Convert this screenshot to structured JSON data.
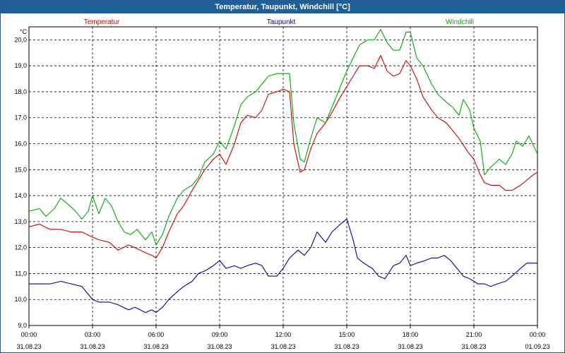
{
  "window": {
    "title": "Temperatur, Taupunkt, Windchill [°C]"
  },
  "chart_data": {
    "type": "line",
    "title": "Temperatur, Taupunkt, Windchill [°C]",
    "ylabel": "°C",
    "ylim": [
      9.0,
      20.5
    ],
    "yticks": [
      "9,0",
      "10,0",
      "11,0",
      "12,0",
      "13,0",
      "14,0",
      "15,0",
      "16,0",
      "17,0",
      "18,0",
      "19,0",
      "20,0"
    ],
    "xlim": [
      0,
      24
    ],
    "xticks": [
      {
        "time": "00:00",
        "date": "31.08.23"
      },
      {
        "time": "03:00",
        "date": "31.08.23"
      },
      {
        "time": "06:00",
        "date": "31.08.23"
      },
      {
        "time": "09:00",
        "date": "31.08.23"
      },
      {
        "time": "12:00",
        "date": "31.08.23"
      },
      {
        "time": "15:00",
        "date": "31.08.23"
      },
      {
        "time": "18:00",
        "date": "31.08.23"
      },
      {
        "time": "21:00",
        "date": "31.08.23"
      },
      {
        "time": "00:00",
        "date": "01.09.23"
      }
    ],
    "grid": true,
    "legend_position": "top",
    "series": [
      {
        "name": "Temperatur",
        "color": "#cc0000",
        "points": [
          [
            0,
            12.8
          ],
          [
            0.5,
            12.9
          ],
          [
            1,
            12.7
          ],
          [
            1.5,
            12.7
          ],
          [
            2,
            12.6
          ],
          [
            2.5,
            12.6
          ],
          [
            3,
            12.4
          ],
          [
            3.3,
            12.3
          ],
          [
            3.8,
            12.2
          ],
          [
            4.2,
            11.9
          ],
          [
            4.7,
            12.1
          ],
          [
            5,
            12.0
          ],
          [
            5.5,
            11.8
          ],
          [
            5.8,
            11.7
          ],
          [
            6.0,
            11.6
          ],
          [
            6.3,
            12.0
          ],
          [
            6.6,
            12.6
          ],
          [
            7,
            13.3
          ],
          [
            7.3,
            13.6
          ],
          [
            7.7,
            14.2
          ],
          [
            8.0,
            14.6
          ],
          [
            8.3,
            15.0
          ],
          [
            8.7,
            15.4
          ],
          [
            9.0,
            15.6
          ],
          [
            9.3,
            15.2
          ],
          [
            9.7,
            16.0
          ],
          [
            10.0,
            16.8
          ],
          [
            10.3,
            17.1
          ],
          [
            10.7,
            17.0
          ],
          [
            11.0,
            17.3
          ],
          [
            11.3,
            17.9
          ],
          [
            11.7,
            18.0
          ],
          [
            12.0,
            18.1
          ],
          [
            12.3,
            18.0
          ],
          [
            12.5,
            16.0
          ],
          [
            12.8,
            14.9
          ],
          [
            13.0,
            15.0
          ],
          [
            13.3,
            15.8
          ],
          [
            13.6,
            16.4
          ],
          [
            14.0,
            16.8
          ],
          [
            14.3,
            17.2
          ],
          [
            14.7,
            17.8
          ],
          [
            15.0,
            18.2
          ],
          [
            15.3,
            18.6
          ],
          [
            15.6,
            19.0
          ],
          [
            16.0,
            19.0
          ],
          [
            16.3,
            18.9
          ],
          [
            16.6,
            19.4
          ],
          [
            16.9,
            18.8
          ],
          [
            17.2,
            18.6
          ],
          [
            17.5,
            18.7
          ],
          [
            17.8,
            19.2
          ],
          [
            18.0,
            19.0
          ],
          [
            18.3,
            18.5
          ],
          [
            18.6,
            17.8
          ],
          [
            19.0,
            17.3
          ],
          [
            19.3,
            17.0
          ],
          [
            19.7,
            16.8
          ],
          [
            20.0,
            16.5
          ],
          [
            20.3,
            16.2
          ],
          [
            20.7,
            15.7
          ],
          [
            21.0,
            15.4
          ],
          [
            21.3,
            14.8
          ],
          [
            21.5,
            14.5
          ],
          [
            21.8,
            14.4
          ],
          [
            22.2,
            14.4
          ],
          [
            22.5,
            14.2
          ],
          [
            22.8,
            14.2
          ],
          [
            23.2,
            14.4
          ],
          [
            23.5,
            14.6
          ],
          [
            23.8,
            14.8
          ],
          [
            24.0,
            14.9
          ]
        ]
      },
      {
        "name": "Taupunkt",
        "color": "#000099",
        "points": [
          [
            0,
            10.6
          ],
          [
            0.5,
            10.6
          ],
          [
            1,
            10.6
          ],
          [
            1.5,
            10.7
          ],
          [
            2,
            10.6
          ],
          [
            2.5,
            10.5
          ],
          [
            3,
            10.0
          ],
          [
            3.3,
            9.9
          ],
          [
            3.8,
            9.9
          ],
          [
            4.2,
            9.8
          ],
          [
            4.7,
            9.6
          ],
          [
            5,
            9.7
          ],
          [
            5.5,
            9.5
          ],
          [
            5.8,
            9.6
          ],
          [
            6.0,
            9.5
          ],
          [
            6.3,
            9.7
          ],
          [
            6.6,
            10.0
          ],
          [
            7,
            10.3
          ],
          [
            7.3,
            10.5
          ],
          [
            7.7,
            10.7
          ],
          [
            8.0,
            11.0
          ],
          [
            8.3,
            11.1
          ],
          [
            8.7,
            11.3
          ],
          [
            9.0,
            11.5
          ],
          [
            9.3,
            11.2
          ],
          [
            9.7,
            11.3
          ],
          [
            10.0,
            11.2
          ],
          [
            10.3,
            11.3
          ],
          [
            10.7,
            11.4
          ],
          [
            11.0,
            11.3
          ],
          [
            11.3,
            10.9
          ],
          [
            11.7,
            10.9
          ],
          [
            12.0,
            11.2
          ],
          [
            12.3,
            11.6
          ],
          [
            12.7,
            11.9
          ],
          [
            13.0,
            11.7
          ],
          [
            13.3,
            12.0
          ],
          [
            13.6,
            12.6
          ],
          [
            14.0,
            12.2
          ],
          [
            14.3,
            12.6
          ],
          [
            14.7,
            12.9
          ],
          [
            15.0,
            13.1
          ],
          [
            15.3,
            12.3
          ],
          [
            15.5,
            11.6
          ],
          [
            15.8,
            11.4
          ],
          [
            16.2,
            11.2
          ],
          [
            16.5,
            10.9
          ],
          [
            16.8,
            10.8
          ],
          [
            17.2,
            11.3
          ],
          [
            17.5,
            11.4
          ],
          [
            17.8,
            11.7
          ],
          [
            18.0,
            11.3
          ],
          [
            18.3,
            11.4
          ],
          [
            18.7,
            11.5
          ],
          [
            19.0,
            11.6
          ],
          [
            19.3,
            11.6
          ],
          [
            19.6,
            11.7
          ],
          [
            19.9,
            11.5
          ],
          [
            20.2,
            11.2
          ],
          [
            20.5,
            10.9
          ],
          [
            20.8,
            10.8
          ],
          [
            21.2,
            10.6
          ],
          [
            21.5,
            10.6
          ],
          [
            21.8,
            10.5
          ],
          [
            22.1,
            10.6
          ],
          [
            22.5,
            10.7
          ],
          [
            22.8,
            10.9
          ],
          [
            23.2,
            11.2
          ],
          [
            23.5,
            11.4
          ],
          [
            23.8,
            11.4
          ],
          [
            24.0,
            11.4
          ]
        ]
      },
      {
        "name": "Windchill",
        "color": "#00aa00",
        "points": [
          [
            0,
            13.4
          ],
          [
            0.5,
            13.5
          ],
          [
            0.8,
            13.2
          ],
          [
            1.2,
            13.5
          ],
          [
            1.5,
            13.9
          ],
          [
            1.8,
            13.7
          ],
          [
            2.2,
            13.4
          ],
          [
            2.5,
            13.1
          ],
          [
            2.8,
            13.4
          ],
          [
            3.0,
            14.0
          ],
          [
            3.3,
            13.3
          ],
          [
            3.6,
            13.9
          ],
          [
            3.9,
            13.6
          ],
          [
            4.2,
            13.0
          ],
          [
            4.5,
            12.6
          ],
          [
            4.8,
            12.5
          ],
          [
            5.1,
            12.7
          ],
          [
            5.5,
            12.3
          ],
          [
            5.8,
            12.6
          ],
          [
            6.0,
            12.1
          ],
          [
            6.3,
            12.5
          ],
          [
            6.6,
            13.2
          ],
          [
            7.0,
            13.9
          ],
          [
            7.3,
            14.2
          ],
          [
            7.7,
            14.4
          ],
          [
            8.0,
            14.7
          ],
          [
            8.3,
            15.3
          ],
          [
            8.7,
            15.6
          ],
          [
            9.0,
            16.1
          ],
          [
            9.3,
            15.8
          ],
          [
            9.7,
            16.7
          ],
          [
            10.0,
            17.5
          ],
          [
            10.3,
            17.8
          ],
          [
            10.7,
            18.0
          ],
          [
            11.0,
            18.3
          ],
          [
            11.3,
            18.6
          ],
          [
            11.7,
            18.7
          ],
          [
            12.0,
            18.7
          ],
          [
            12.3,
            18.7
          ],
          [
            12.5,
            16.8
          ],
          [
            12.8,
            15.4
          ],
          [
            13.0,
            15.3
          ],
          [
            13.3,
            16.2
          ],
          [
            13.6,
            17.0
          ],
          [
            14.0,
            16.8
          ],
          [
            14.3,
            17.4
          ],
          [
            14.7,
            18.2
          ],
          [
            15.0,
            18.8
          ],
          [
            15.3,
            19.3
          ],
          [
            15.6,
            19.8
          ],
          [
            16.0,
            20.0
          ],
          [
            16.3,
            20.0
          ],
          [
            16.6,
            20.4
          ],
          [
            16.9,
            19.9
          ],
          [
            17.2,
            19.6
          ],
          [
            17.5,
            19.6
          ],
          [
            17.8,
            20.3
          ],
          [
            18.0,
            20.3
          ],
          [
            18.3,
            19.3
          ],
          [
            18.6,
            19.0
          ],
          [
            19.0,
            18.3
          ],
          [
            19.3,
            17.9
          ],
          [
            19.7,
            17.6
          ],
          [
            20.0,
            17.4
          ],
          [
            20.3,
            17.1
          ],
          [
            20.5,
            17.7
          ],
          [
            20.8,
            17.3
          ],
          [
            21.0,
            16.6
          ],
          [
            21.3,
            16.1
          ],
          [
            21.5,
            14.8
          ],
          [
            21.8,
            15.1
          ],
          [
            22.2,
            15.4
          ],
          [
            22.5,
            15.2
          ],
          [
            22.8,
            15.6
          ],
          [
            23.0,
            16.1
          ],
          [
            23.3,
            15.9
          ],
          [
            23.6,
            16.3
          ],
          [
            24.0,
            15.6
          ]
        ]
      }
    ]
  }
}
